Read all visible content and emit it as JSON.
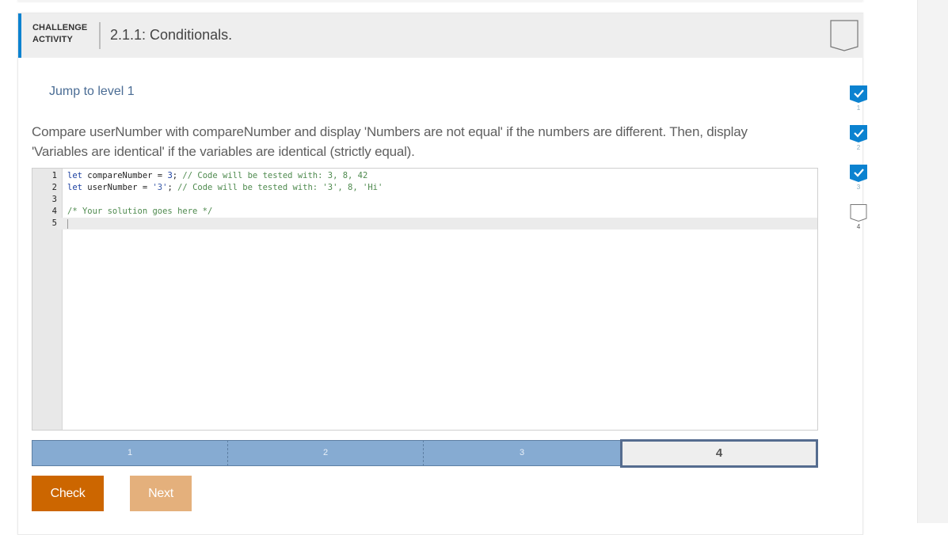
{
  "header": {
    "activity_label": "CHALLENGE ACTIVITY",
    "title": "2.1.1: Conditionals.",
    "badge_icon": "incomplete-badge-icon"
  },
  "jump_link": "Jump to level 1",
  "prompt": "Compare userNumber with compareNumber and display 'Numbers are not equal' if the numbers are different. Then, display 'Variables are identical' if the variables are identical (strictly equal).",
  "editor": {
    "lines": [
      {
        "number": "1",
        "tokens": [
          {
            "t": "let",
            "c": "kw"
          },
          {
            "t": " compareNumber = ",
            "c": ""
          },
          {
            "t": "3",
            "c": "num"
          },
          {
            "t": "; ",
            "c": ""
          },
          {
            "t": "// Code will be tested with: 3, 8, 42",
            "c": "cm"
          }
        ]
      },
      {
        "number": "2",
        "tokens": [
          {
            "t": "let",
            "c": "kw"
          },
          {
            "t": " userNumber = ",
            "c": ""
          },
          {
            "t": "'3'",
            "c": "str"
          },
          {
            "t": "; ",
            "c": ""
          },
          {
            "t": "// Code will be tested with: '3', 8, 'Hi'",
            "c": "cm"
          }
        ]
      },
      {
        "number": "3",
        "tokens": []
      },
      {
        "number": "4",
        "tokens": [
          {
            "t": "/* Your solution goes here */",
            "c": "cm"
          }
        ]
      },
      {
        "number": "5",
        "tokens": [],
        "active": true
      }
    ]
  },
  "progress": {
    "segments": [
      {
        "label": "1",
        "state": "completed"
      },
      {
        "label": "2",
        "state": "completed"
      },
      {
        "label": "3",
        "state": "completed"
      },
      {
        "label": "4",
        "state": "current"
      }
    ]
  },
  "buttons": {
    "check": "Check",
    "next": "Next"
  },
  "levels": [
    {
      "label": "1",
      "completed": true
    },
    {
      "label": "2",
      "completed": true
    },
    {
      "label": "3",
      "completed": true
    },
    {
      "label": "4",
      "completed": false
    }
  ],
  "colors": {
    "accent": "#0b82d0",
    "check_button": "#cc6600",
    "next_button_disabled": "#e4b07c",
    "progress_completed": "#86abd2",
    "progress_border": "#556c8f"
  }
}
